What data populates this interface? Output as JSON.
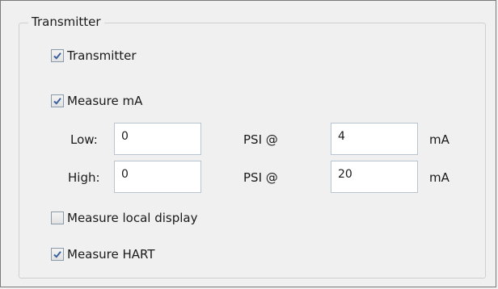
{
  "group": {
    "title": "Transmitter"
  },
  "checkboxes": {
    "transmitter": {
      "label": "Transmitter",
      "checked": true
    },
    "measure_ma": {
      "label": "Measure mA",
      "checked": true
    },
    "measure_local_display": {
      "label": "Measure local display",
      "checked": false
    },
    "measure_hart": {
      "label": "Measure HART",
      "checked": true
    }
  },
  "low": {
    "label": "Low:",
    "psi_value": "0",
    "psi_label": "PSI @",
    "ma_value": "4",
    "ma_unit": "mA"
  },
  "high": {
    "label": "High:",
    "psi_value": "0",
    "psi_label": "PSI @",
    "ma_value": "20",
    "ma_unit": "mA"
  },
  "colors": {
    "check_mark": "#3a5f9e",
    "background": "#f0f0f0",
    "group_border": "#cfcfcf"
  }
}
